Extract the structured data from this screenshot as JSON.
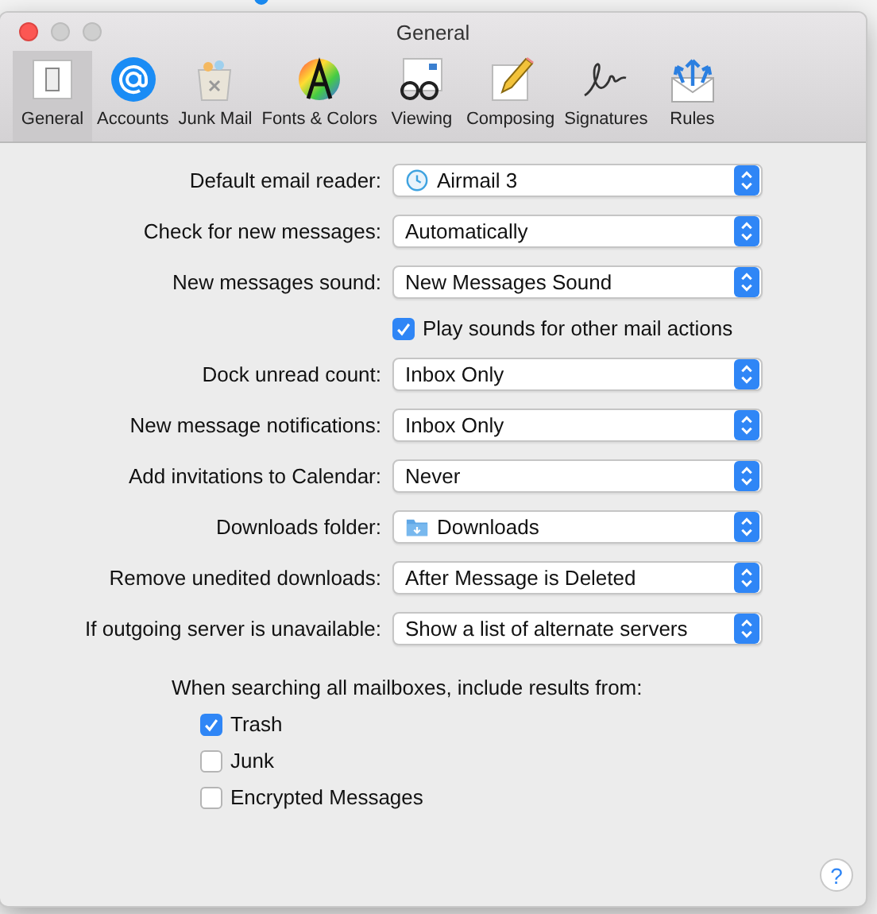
{
  "window": {
    "title": "General"
  },
  "toolbar": [
    {
      "label": "General",
      "selected": true
    },
    {
      "label": "Accounts",
      "selected": false
    },
    {
      "label": "Junk Mail",
      "selected": false
    },
    {
      "label": "Fonts & Colors",
      "selected": false
    },
    {
      "label": "Viewing",
      "selected": false
    },
    {
      "label": "Composing",
      "selected": false
    },
    {
      "label": "Signatures",
      "selected": false
    },
    {
      "label": "Rules",
      "selected": false
    }
  ],
  "settings": [
    {
      "kind": "app-popup",
      "label": "Default email reader:",
      "value": "Airmail 3"
    },
    {
      "kind": "popup",
      "label": "Check for new messages:",
      "value": "Automatically"
    },
    {
      "kind": "popup",
      "label": "New messages sound:",
      "value": "New Messages Sound"
    },
    {
      "kind": "checkbox",
      "label": "Play sounds for other mail actions",
      "checked": true
    },
    {
      "kind": "popup",
      "label": "Dock unread count:",
      "value": "Inbox Only"
    },
    {
      "kind": "popup",
      "label": "New message notifications:",
      "value": "Inbox Only"
    },
    {
      "kind": "popup",
      "label": "Add invitations to Calendar:",
      "value": "Never"
    },
    {
      "kind": "folder-popup",
      "label": "Downloads folder:",
      "value": "Downloads"
    },
    {
      "kind": "popup",
      "label": "Remove unedited downloads:",
      "value": "After Message is Deleted"
    },
    {
      "kind": "popup",
      "label": "If outgoing server is unavailable:",
      "value": "Show a list of alternate servers"
    }
  ],
  "search_include": {
    "heading": "When searching all mailboxes, include results from:",
    "options": [
      {
        "label": "Trash",
        "checked": true
      },
      {
        "label": "Junk",
        "checked": false
      },
      {
        "label": "Encrypted Messages",
        "checked": false
      }
    ]
  },
  "help_button": {
    "label": "?"
  }
}
